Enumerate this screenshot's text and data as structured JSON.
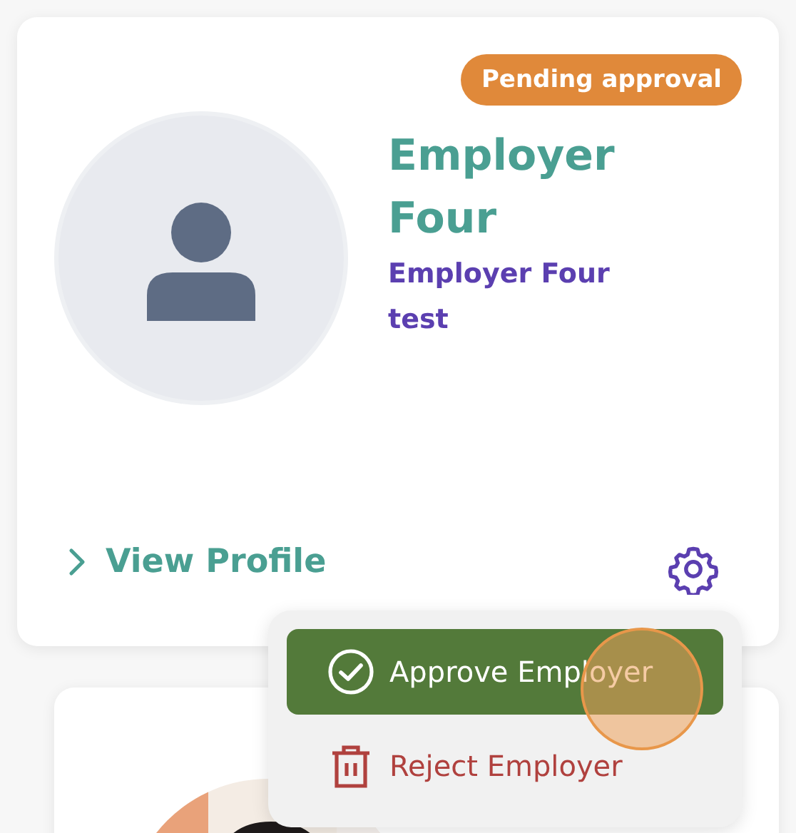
{
  "cards": [
    {
      "badge": "Pending approval",
      "name": "Employer Four",
      "company": "Employer Four test",
      "avatar": {
        "kind": "placeholder"
      },
      "view_profile": "View Profile"
    },
    {
      "avatar": {
        "kind": "picture"
      }
    }
  ],
  "menu": {
    "items": [
      {
        "kind": "approve",
        "label": "Approve Employer",
        "selected": true
      },
      {
        "kind": "reject",
        "label": "Reject Employer",
        "selected": false
      }
    ]
  }
}
